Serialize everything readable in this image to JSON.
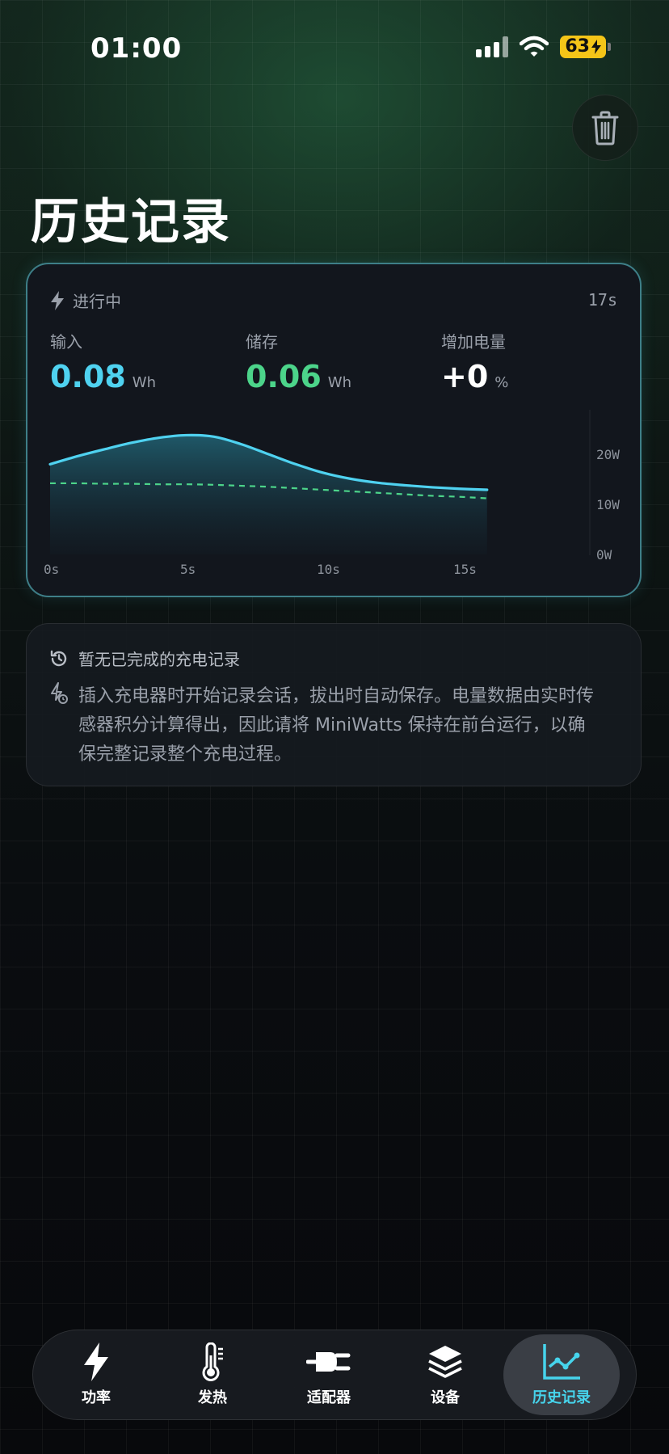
{
  "status_bar": {
    "time": "01:00",
    "battery": "63"
  },
  "page": {
    "title": "历史记录"
  },
  "live_session": {
    "status": "进行中",
    "duration": "17s",
    "stats": [
      {
        "label": "输入",
        "value": "0.08",
        "unit": "Wh",
        "color": "#4fd2f0"
      },
      {
        "label": "储存",
        "value": "0.06",
        "unit": "Wh",
        "color": "#4cd48a"
      },
      {
        "label": "增加电量",
        "value": "+0",
        "unit": "%",
        "color": "#ffffff"
      }
    ]
  },
  "chart_data": {
    "type": "area",
    "x": [
      0,
      1,
      2,
      3,
      4,
      5,
      6,
      7,
      8,
      9,
      10,
      11,
      12,
      13,
      14,
      15,
      16
    ],
    "x_ticks": [
      "0s",
      "5s",
      "10s",
      "15s"
    ],
    "x_tick_values": [
      0,
      5,
      10,
      15
    ],
    "y_ticks": [
      "20W",
      "10W",
      "0W"
    ],
    "y_tick_values": [
      20,
      10,
      0
    ],
    "ylim": [
      0,
      30
    ],
    "series": [
      {
        "style": "solid-area",
        "color": "#4fd2f0",
        "values": [
          18.0,
          19.6,
          21.0,
          22.3,
          23.3,
          23.8,
          23.5,
          22.0,
          20.0,
          18.0,
          16.3,
          15.1,
          14.3,
          13.8,
          13.4,
          13.1,
          12.9
        ]
      },
      {
        "style": "dashed",
        "color": "#4cd48a",
        "values": [
          14.2,
          14.2,
          14.1,
          14.1,
          14.0,
          14.0,
          13.9,
          13.7,
          13.5,
          13.2,
          12.9,
          12.6,
          12.3,
          12.0,
          11.7,
          11.5,
          11.2
        ]
      }
    ]
  },
  "empty_state": {
    "title": "暂无已完成的充电记录",
    "description": "插入充电器时开始记录会话，拔出时自动保存。电量数据由实时传感器积分计算得出，因此请将 MiniWatts 保持在前台运行，以确保完整记录整个充电过程。"
  },
  "tabs": [
    {
      "label": "功率",
      "icon": "bolt-icon"
    },
    {
      "label": "发热",
      "icon": "thermometer-icon"
    },
    {
      "label": "适配器",
      "icon": "plug-icon"
    },
    {
      "label": "设备",
      "icon": "layers-icon"
    },
    {
      "label": "历史记录",
      "icon": "chart-line-icon"
    }
  ]
}
